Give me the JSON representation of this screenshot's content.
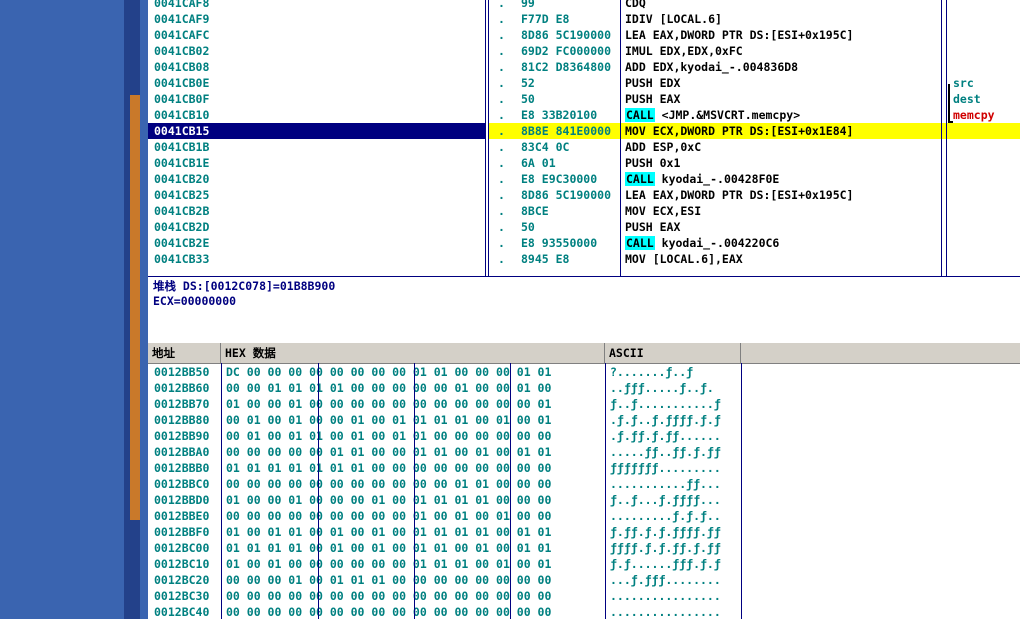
{
  "disasm": {
    "rows": [
      {
        "addr": "0041CAF8",
        "hex": "99",
        "ins": "CDQ"
      },
      {
        "addr": "0041CAF9",
        "hex": "F77D E8",
        "ins": "IDIV [LOCAL.6]"
      },
      {
        "addr": "0041CAFC",
        "hex": "8D86 5C190000",
        "ins": "LEA EAX,DWORD PTR DS:[ESI+0x195C]"
      },
      {
        "addr": "0041CB02",
        "hex": "69D2 FC000000",
        "ins": "IMUL EDX,EDX,0xFC"
      },
      {
        "addr": "0041CB08",
        "hex": "81C2 D8364800",
        "ins": "ADD EDX,kyodai_-.004836D8"
      },
      {
        "addr": "0041CB0E",
        "hex": "52",
        "ins": "PUSH EDX",
        "cmt": "src"
      },
      {
        "addr": "0041CB0F",
        "hex": "50",
        "ins": "PUSH EAX",
        "cmt": "dest"
      },
      {
        "addr": "0041CB10",
        "hex": "E8 33B20100",
        "call": "CALL",
        "ins": "<JMP.&MSVCRT.memcpy>",
        "cmt": "memcpy"
      },
      {
        "addr": "0041CB15",
        "hex": "8B8E 841E0000",
        "ins": "MOV ECX,DWORD PTR DS:[ESI+0x1E84]"
      },
      {
        "addr": "0041CB1B",
        "hex": "83C4 0C",
        "ins": "ADD ESP,0xC"
      },
      {
        "addr": "0041CB1E",
        "hex": "6A 01",
        "ins": "PUSH 0x1"
      },
      {
        "addr": "0041CB20",
        "hex": "E8 E9C30000",
        "call": "CALL",
        "ins": "kyodai_-.00428F0E"
      },
      {
        "addr": "0041CB25",
        "hex": "8D86 5C190000",
        "ins": "LEA EAX,DWORD PTR DS:[ESI+0x195C]"
      },
      {
        "addr": "0041CB2B",
        "hex": "8BCE",
        "ins": "MOV ECX,ESI"
      },
      {
        "addr": "0041CB2D",
        "hex": "50",
        "ins": "PUSH EAX"
      },
      {
        "addr": "0041CB2E",
        "hex": "E8 93550000",
        "call": "CALL",
        "ins": "kyodai_-.004220C6"
      },
      {
        "addr": "0041CB33",
        "hex": "8945 E8",
        "ins": "MOV [LOCAL.6],EAX"
      }
    ]
  },
  "info": {
    "line1": "堆栈 DS:[0012C078]=01B8B900",
    "line2": "ECX=00000000"
  },
  "dump": {
    "col_addr": "地址",
    "col_hex": "HEX 数据",
    "col_ascii": "ASCII",
    "rows": [
      {
        "addr": "0012BB50",
        "hex": "DC 00 00 00 00 00 00 00 00 01 01 00 00 00 01 01",
        "ascii": "?.......ƒ..ƒ"
      },
      {
        "addr": "0012BB60",
        "hex": "00 00 01 01 01 01 00 00 00 00 00 01 00 00 01 00",
        "ascii": "..ƒƒƒ.....ƒ..ƒ."
      },
      {
        "addr": "0012BB70",
        "hex": "01 00 00 01 00 00 00 00 00 00 00 00 00 00 00 01",
        "ascii": "ƒ..ƒ...........ƒ"
      },
      {
        "addr": "0012BB80",
        "hex": "00 01 00 01 00 00 01 00 01 01 01 01 00 01 00 01",
        "ascii": ".ƒ.ƒ..ƒ.ƒƒƒƒ.ƒ.ƒ"
      },
      {
        "addr": "0012BB90",
        "hex": "00 01 00 01 01 00 01 00 01 01 00 00 00 00 00 00",
        "ascii": ".ƒ.ƒƒ.ƒ.ƒƒ......"
      },
      {
        "addr": "0012BBA0",
        "hex": "00 00 00 00 00 01 01 00 00 01 01 00 01 00 01 01",
        "ascii": ".....ƒƒ..ƒƒ.ƒ.ƒƒ"
      },
      {
        "addr": "0012BBB0",
        "hex": "01 01 01 01 01 01 01 00 00 00 00 00 00 00 00 00",
        "ascii": "ƒƒƒƒƒƒƒ........."
      },
      {
        "addr": "0012BBC0",
        "hex": "00 00 00 00 00 00 00 00 00 00 00 01 01 00 00 00",
        "ascii": "...........ƒƒ..."
      },
      {
        "addr": "0012BBD0",
        "hex": "01 00 00 01 00 00 00 01 00 01 01 01 01 00 00 00",
        "ascii": "ƒ..ƒ...ƒ.ƒƒƒƒ..."
      },
      {
        "addr": "0012BBE0",
        "hex": "00 00 00 00 00 00 00 00 00 01 00 01 00 01 00 00",
        "ascii": ".........ƒ.ƒ.ƒ.."
      },
      {
        "addr": "0012BBF0",
        "hex": "01 00 01 01 00 01 00 01 00 01 01 01 01 00 01 01",
        "ascii": "ƒ.ƒƒ.ƒ.ƒ.ƒƒƒƒ.ƒƒ"
      },
      {
        "addr": "0012BC00",
        "hex": "01 01 01 01 00 01 00 01 00 01 01 00 01 00 01 01",
        "ascii": "ƒƒƒƒ.ƒ.ƒ.ƒƒ.ƒ.ƒƒ"
      },
      {
        "addr": "0012BC10",
        "hex": "01 00 01 00 00 00 00 00 00 01 01 01 00 01 00 01",
        "ascii": "ƒ.ƒ......ƒƒƒ.ƒ.ƒ"
      },
      {
        "addr": "0012BC20",
        "hex": "00 00 00 01 00 01 01 01 00 00 00 00 00 00 00 00",
        "ascii": "...ƒ.ƒƒƒ........"
      },
      {
        "addr": "0012BC30",
        "hex": "00 00 00 00 00 00 00 00 00 00 00 00 00 00 00 00",
        "ascii": "................"
      },
      {
        "addr": "0012BC40",
        "hex": "00 00 00 00 00 00 00 00 00 00 00 00 00 00 00 00",
        "ascii": "................"
      }
    ]
  }
}
